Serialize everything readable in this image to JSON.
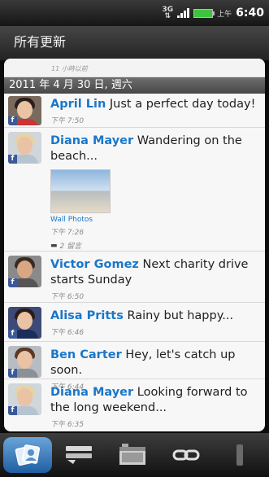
{
  "status": {
    "network": "3G",
    "ampm": "上午",
    "time": "6:40"
  },
  "header": {
    "title": "所有更新"
  },
  "prev_item": {
    "time": "11 小時以前"
  },
  "date_header": "2011 年 4 月 30 日, 週六",
  "feed": [
    {
      "author": "April Lin",
      "message": "Just a perfect day today!",
      "time": "下午 7:50"
    },
    {
      "author": "Diana Mayer",
      "message": "Wandering on the beach...",
      "time": "下午 7:26",
      "photo_caption": "Wall Photos",
      "comments": "2 留言"
    },
    {
      "author": "Victor Gomez",
      "message": "Next charity drive starts Sunday",
      "time": "下午 6:50"
    },
    {
      "author": "Alisa Pritts",
      "message": "Rainy but happy...",
      "time": "下午 6:46"
    },
    {
      "author": "Ben Carter",
      "message": "Hey, let's catch up soon.",
      "time": "下午 6:44"
    },
    {
      "author": "Diana Mayer",
      "message": "Looking forward to the long weekend...",
      "time": "下午 6:35"
    }
  ],
  "badge": "f",
  "tabs": [
    {
      "icon": "friends-icon",
      "active": true
    },
    {
      "icon": "status-list-icon",
      "active": false
    },
    {
      "icon": "photos-icon",
      "active": false
    },
    {
      "icon": "links-icon",
      "active": false
    },
    {
      "icon": "more-icon",
      "active": false
    }
  ]
}
